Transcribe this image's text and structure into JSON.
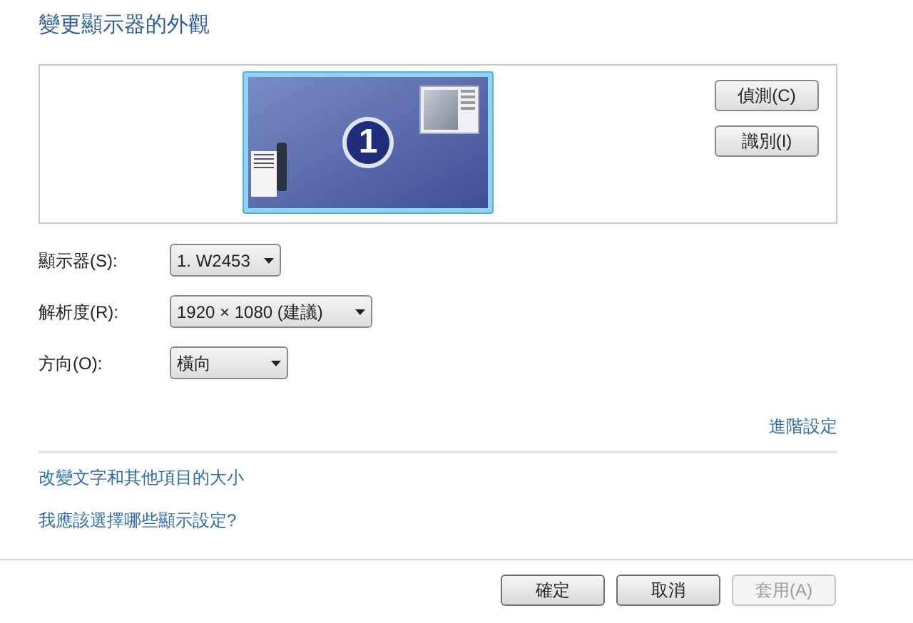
{
  "title": "變更顯示器的外觀",
  "preview": {
    "monitor_number": "1",
    "selected": true
  },
  "preview_buttons": [
    {
      "label": "偵測(C)"
    },
    {
      "label": "識別(I)"
    }
  ],
  "settings": [
    {
      "label": "顯示器(S):",
      "value": "1. W2453"
    },
    {
      "label": "解析度(R):",
      "value": "1920 × 1080 (建議)"
    },
    {
      "label": "方向(O):",
      "value": "橫向"
    }
  ],
  "advanced_link": "進階設定",
  "links": [
    "改變文字和其他項目的大小",
    "我應該選擇哪些顯示設定?"
  ],
  "footer_buttons": [
    {
      "label": "確定",
      "disabled": false
    },
    {
      "label": "取消",
      "disabled": false
    },
    {
      "label": "套用(A)",
      "disabled": true
    }
  ]
}
